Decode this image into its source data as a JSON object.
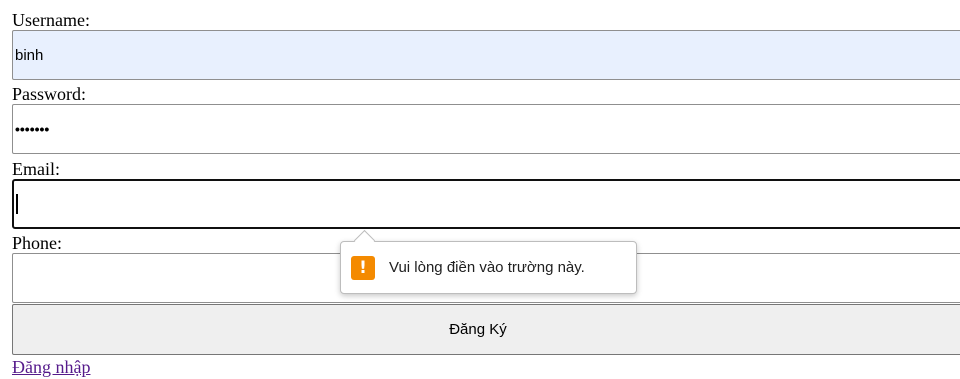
{
  "form": {
    "username_label": "Username:",
    "username_value": "binh",
    "password_label": "Password:",
    "password_value": "•••••••",
    "email_label": "Email:",
    "email_value": "",
    "phone_label": "Phone:",
    "phone_value": "",
    "submit_label": "Đăng Ký",
    "login_link": "Đăng nhập"
  },
  "validation_tooltip": {
    "icon": "warning-icon",
    "icon_glyph": "!",
    "message": "Vui lòng điền vào trường này."
  },
  "colors": {
    "autofill_bg": "#e8f0fe",
    "warning": "#f48a00",
    "visited_link": "#551a8b"
  }
}
